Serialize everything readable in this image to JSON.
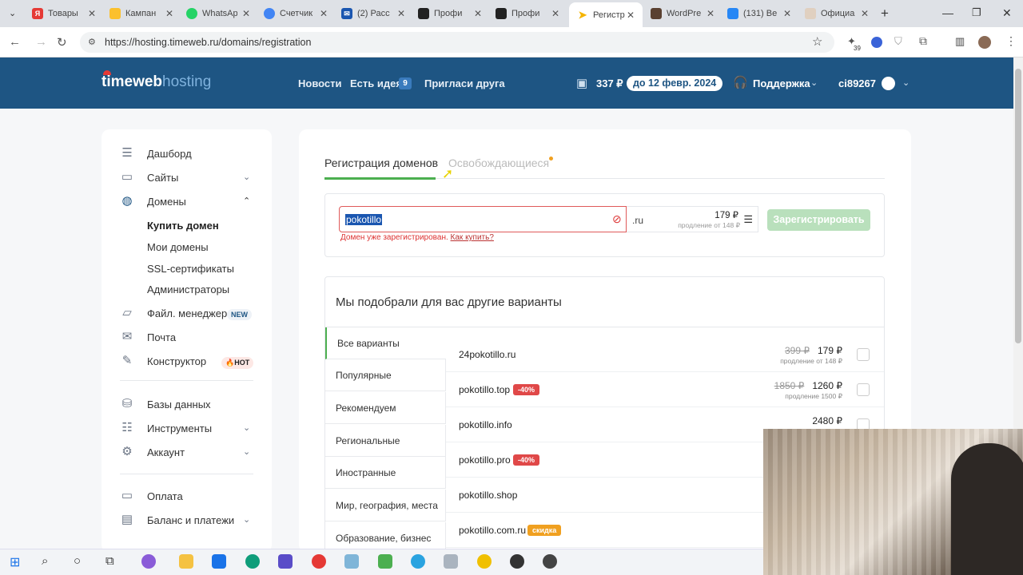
{
  "browser": {
    "tabs": [
      {
        "title": "Товары",
        "icon": "yandex-icon",
        "color": "#e53935"
      },
      {
        "title": "Кампан",
        "icon": "campaign-icon",
        "color": "#fbc02d"
      },
      {
        "title": "WhatsAp",
        "icon": "whatsapp-icon",
        "color": "#25d366"
      },
      {
        "title": "Счетчик",
        "icon": "counter-icon",
        "color": "#4285f4"
      },
      {
        "title": "(2) Расс",
        "icon": "mail-icon",
        "color": "#1a56b0"
      },
      {
        "title": "Профи",
        "icon": "profile-icon",
        "color": "#222222"
      },
      {
        "title": "Профи",
        "icon": "profile-icon",
        "color": "#222222"
      },
      {
        "title": "Регистр",
        "icon": "timeweb-icon",
        "color": "#f5b400"
      },
      {
        "title": "WordPre",
        "icon": "wordpress-icon",
        "color": "#5a4030"
      },
      {
        "title": "(131) Ве",
        "icon": "vk-icon",
        "color": "#2787f5"
      },
      {
        "title": "Официа",
        "icon": "1c-icon",
        "color": "#e0d0c0"
      }
    ],
    "url": "https://hosting.timeweb.ru/domains/registration",
    "extension_badge": "39"
  },
  "header": {
    "logo_main": "timeweb",
    "logo_sub": "hosting",
    "nav": {
      "news": "Новости",
      "idea": "Есть идея",
      "idea_count": "9",
      "invite": "Пригласи друга"
    },
    "balance": "337 ₽",
    "paid_until": "до 12 февр. 2024",
    "support": "Поддержка",
    "user": "ci89267"
  },
  "sidebar": {
    "dashboard": "Дашборд",
    "sites": "Сайты",
    "domains": "Домены",
    "buy_domain": "Купить домен",
    "my_domains": "Мои домены",
    "ssl": "SSL-сертификаты",
    "admins": "Администраторы",
    "file_manager": "Файл. менеджер",
    "new_badge": "NEW",
    "mail": "Почта",
    "constructor": "Конструктор",
    "hot_badge": "🔥HOT",
    "databases": "Базы данных",
    "tools": "Инструменты",
    "account": "Аккаунт",
    "payment": "Оплата",
    "balance_payments": "Баланс и платежи"
  },
  "main": {
    "tab_registration": "Регистрация доменов",
    "tab_expiring": "Освобождающиеся",
    "domain_value": "pokotillo",
    "zone": ".ru",
    "zone_price": "179 ₽",
    "zone_renewal": "продление от 148 ₽",
    "error_text": "Домен уже зарегистрирован.",
    "error_link": "Как купить?",
    "register_button": "Зарегистрировать",
    "suggestions_title": "Мы подобрали для вас другие варианты",
    "categories": [
      "Все варианты",
      "Популярные",
      "Рекомендуем",
      "Региональные",
      "Иностранные",
      "Мир, география, места",
      "Образование, бизнес"
    ],
    "results": [
      {
        "name": "24pokotillo.ru",
        "old_price": "399 ₽",
        "price": "179 ₽",
        "renewal": "продление от 148 ₽",
        "badge": ""
      },
      {
        "name": "pokotillo.top",
        "old_price": "1850 ₽",
        "price": "1260 ₽",
        "renewal": "продление 1500 ₽",
        "badge": "-40%"
      },
      {
        "name": "pokotillo.info",
        "old_price": "",
        "price": "2480 ₽",
        "renewal": "",
        "badge": ""
      },
      {
        "name": "pokotillo.pro",
        "old_price": "",
        "price": "",
        "renewal": "",
        "badge": "-40%"
      },
      {
        "name": "pokotillo.shop",
        "old_price": "",
        "price": "",
        "renewal": "",
        "badge": ""
      },
      {
        "name": "pokotillo.com.ru",
        "old_price": "",
        "price": "",
        "renewal": "",
        "badge": "скидка"
      }
    ]
  },
  "colors": {
    "header_bg": "#1e5583",
    "accent_green": "#4caf50",
    "error_red": "#e05a5a",
    "promo_red": "#e04848",
    "promo_orange": "#f0a020"
  }
}
